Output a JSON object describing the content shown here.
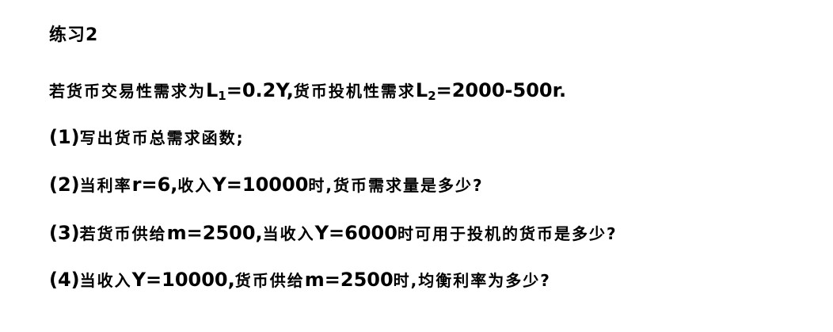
{
  "title": "练习2",
  "problem": {
    "intro_a": "若货币交易性需求为",
    "L1_base": "L",
    "L1_sub": "1",
    "L1_rest": "=0.2Y,",
    "intro_b": "货币投机性需求",
    "L2_base": "L",
    "L2_sub": "2",
    "L2_rest": "=2000-500r."
  },
  "questions": [
    {
      "num": "(1)",
      "parts": [
        "写出货币总需求函数;"
      ]
    },
    {
      "num": "(2)",
      "parts": [
        "当利率",
        "r=6,",
        "收入",
        "Y=10000",
        "时,货币需求量是多少?"
      ]
    },
    {
      "num": "(3)",
      "parts": [
        "若货币供给",
        "m=2500,",
        "当收入",
        "Y=6000",
        "时可用于投机的货币是多少?"
      ]
    },
    {
      "num": "(4)",
      "parts": [
        "当收入",
        "Y=10000,",
        "货币供给",
        "m=2500",
        "时,均衡利率为多少?"
      ]
    }
  ]
}
